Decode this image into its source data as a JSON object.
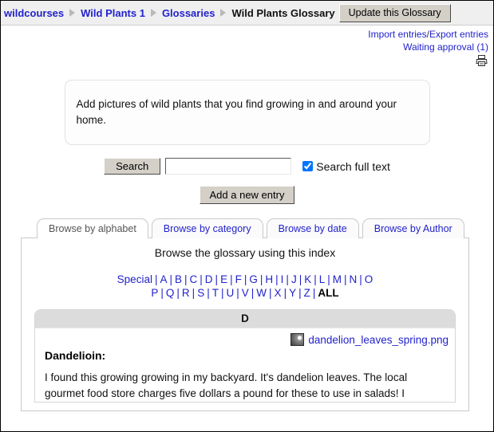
{
  "breadcrumb": {
    "items": [
      {
        "label": "wildcourses",
        "current": false
      },
      {
        "label": "Wild Plants 1",
        "current": false
      },
      {
        "label": "Glossaries",
        "current": false
      },
      {
        "label": "Wild Plants Glossary",
        "current": true
      }
    ],
    "update_button": "Update this Glossary"
  },
  "toplinks": {
    "import": "Import entries",
    "separator": "/",
    "export": "Export entries",
    "waiting_approval": "Waiting approval (1)",
    "printer_icon": "printer-icon"
  },
  "description": {
    "text": "Add pictures of wild plants that you find growing in and around your home."
  },
  "search": {
    "button_label": "Search",
    "input_value": "",
    "input_placeholder": "",
    "fulltext_label": "Search full text",
    "fulltext_checked": true
  },
  "actions": {
    "add_entry_label": "Add a new entry"
  },
  "tabs": [
    {
      "label": "Browse by alphabet",
      "active": true
    },
    {
      "label": "Browse by category",
      "active": false
    },
    {
      "label": "Browse by date",
      "active": false
    },
    {
      "label": "Browse by Author",
      "active": false
    }
  ],
  "index": {
    "title": "Browse the glossary using this index",
    "row1": [
      "Special",
      "A",
      "B",
      "C",
      "D",
      "E",
      "F",
      "G",
      "H",
      "I",
      "J",
      "K",
      "L",
      "M",
      "N",
      "O"
    ],
    "row2": [
      "P",
      "Q",
      "R",
      "S",
      "T",
      "U",
      "V",
      "W",
      "X",
      "Y",
      "Z",
      "ALL"
    ],
    "current": "ALL"
  },
  "entries": [
    {
      "letter": "D",
      "attachment": "dandelion_leaves_spring.png",
      "term": "Dandelioin:",
      "body": "I found this growing growing in my backyard. It's dandelion leaves. The local gourmet food store charges five dollars a pound for these to use in salads! I"
    }
  ],
  "colors": {
    "link": "#2222cc",
    "navbar_bg": "#efefef",
    "entry_head_bg": "#dcdcdc",
    "button_face": "#d4d0c8"
  }
}
